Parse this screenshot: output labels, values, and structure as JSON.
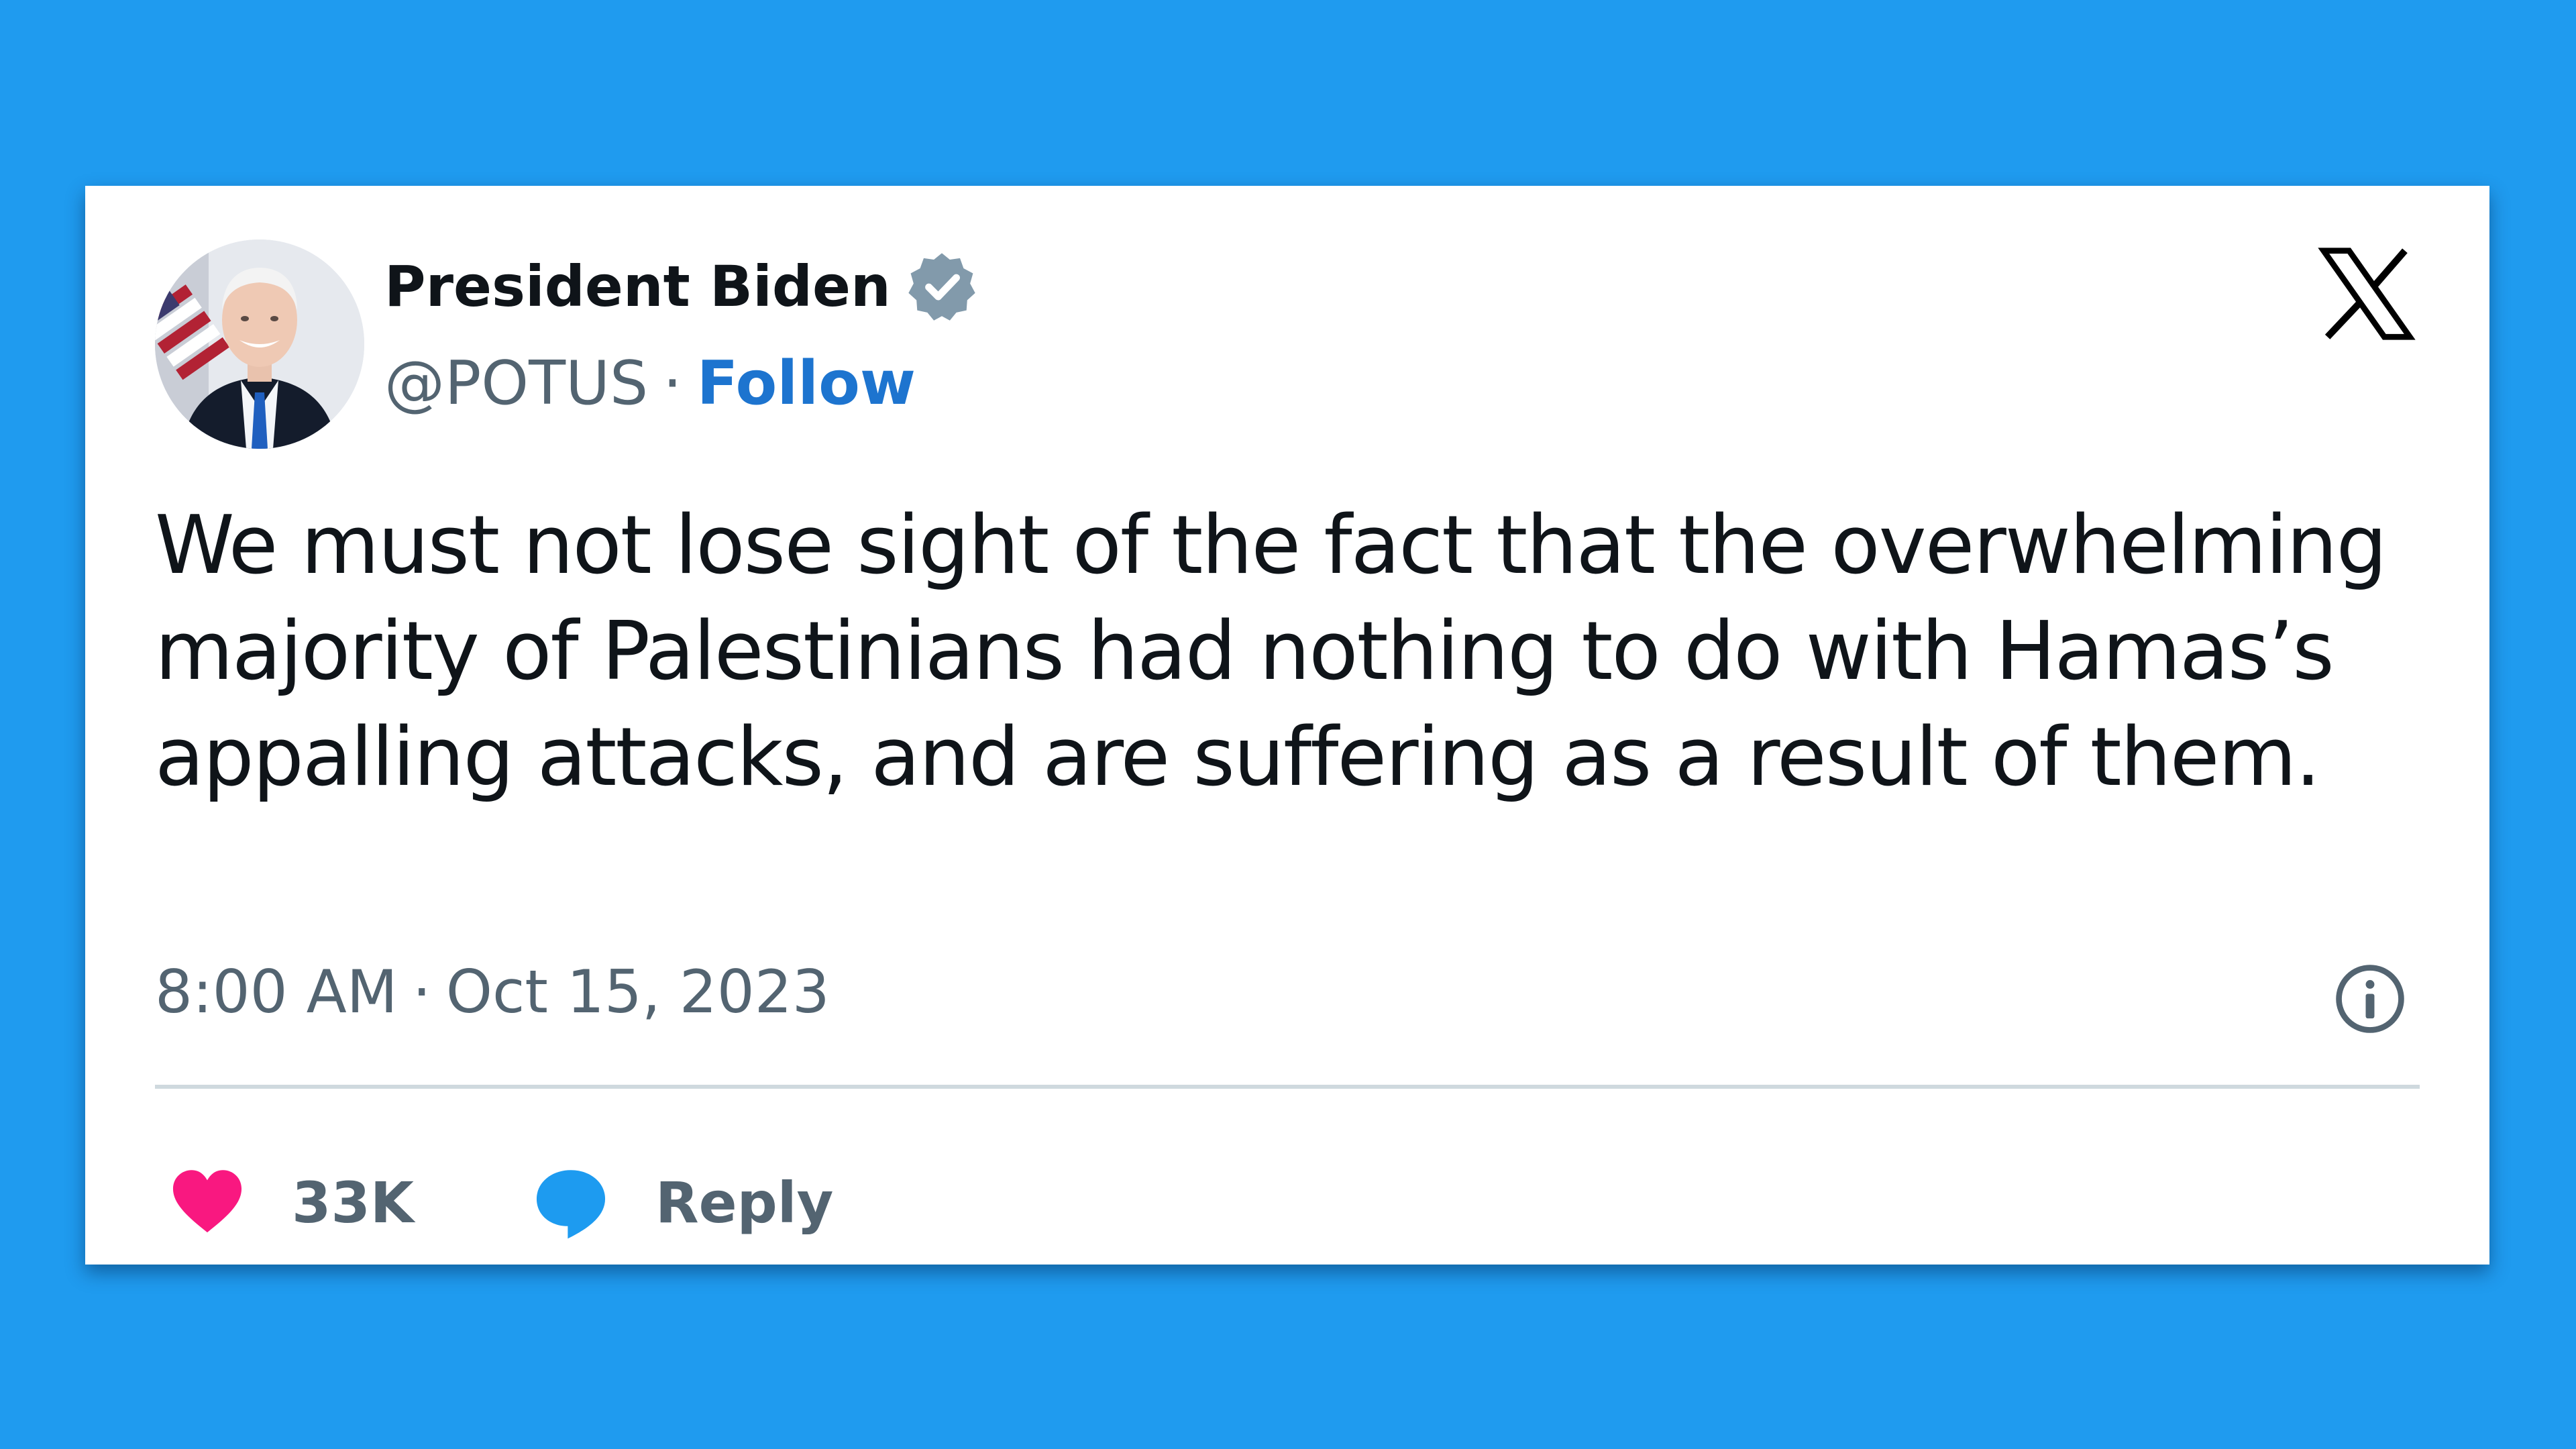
{
  "author": {
    "name": "President Biden",
    "handle": "@POTUS",
    "follow_label": "Follow",
    "verified_icon": "verified-badge-icon",
    "avatar": "portrait-photo"
  },
  "platform": {
    "logo_icon": "x-logo-icon"
  },
  "tweet": {
    "text": "We must not lose sight of the fact that the overwhelming majority of Palestinians had nothing to do with Hamas’s appalling attacks, and are suffering as a result of them.",
    "time": "8:00 AM",
    "date": "Oct 15, 2023",
    "separator": "·"
  },
  "actions": {
    "likes_count": "33K",
    "like_icon": "heart-icon",
    "reply_label": "Reply",
    "reply_icon": "speech-bubble-icon",
    "info_icon": "info-icon"
  },
  "colors": {
    "background": "#1f9bef",
    "follow": "#1d74cf",
    "heart": "#f91880",
    "reply_bubble": "#1d9bf0",
    "verified": "#829aab",
    "muted_text": "#536471"
  }
}
